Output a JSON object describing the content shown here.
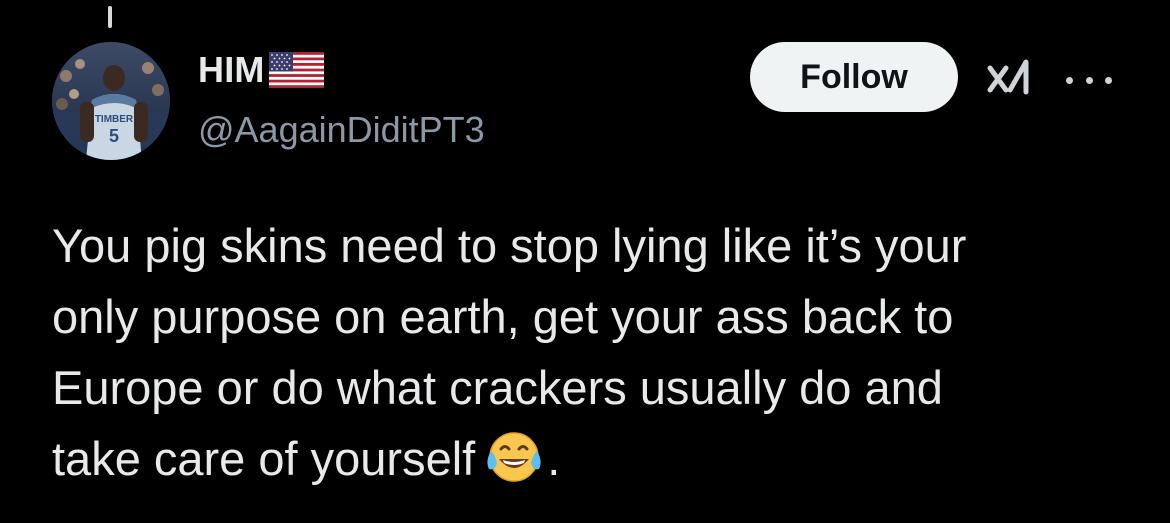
{
  "post": {
    "author": {
      "display_name": "HIM",
      "flag": "us-flag-icon",
      "handle": "@AagainDiditPT3",
      "avatar": "avatar-basketball-player-jersey-5"
    },
    "actions": {
      "follow_label": "Follow",
      "grok_icon": "grok-icon",
      "more_icon": "more-icon"
    },
    "body": {
      "lines": [
        "You pig skins need to stop lying like it’s your",
        "only purpose on earth, get your ass back to",
        "Europe or do what crackers usually do and",
        "take care of yourself"
      ],
      "trailing_emoji": "face-with-tears-of-joy-icon",
      "trailing_text": "."
    }
  },
  "colors": {
    "background": "#000000",
    "text_primary": "#e7e9ea",
    "text_secondary": "#8b98a5",
    "follow_bg": "#eff3f4",
    "follow_text": "#0f1419"
  }
}
